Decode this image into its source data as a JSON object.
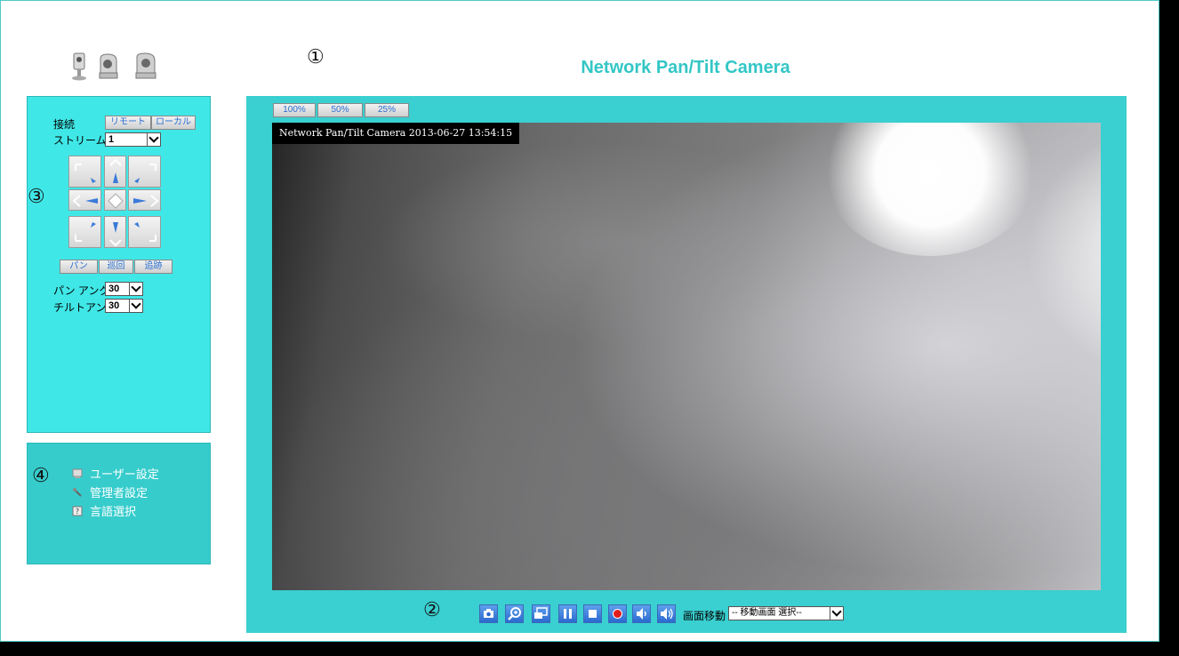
{
  "header": {
    "title": "Network Pan/Tilt Camera",
    "markers": [
      "①",
      "②",
      "③",
      "④"
    ],
    "camera_icons": [
      "box-camera-icon",
      "pan-tilt-camera-icon",
      "dome-camera-icon"
    ]
  },
  "control": {
    "connect_label": "接続",
    "remote_button": "リモート",
    "local_button": "ローカル",
    "stream_label": "ストリーム",
    "stream_value": "1",
    "ptz_buttons": [
      "up-left",
      "up",
      "up-right",
      "left",
      "home",
      "right",
      "down-left",
      "down",
      "down-right"
    ],
    "pan_button": "パン",
    "patrol_button": "巡回",
    "track_button": "追跡",
    "pan_angle_label": "パン アングル",
    "pan_angle_value": "30",
    "tilt_angle_label": "チルトアングル",
    "tilt_angle_value": "30"
  },
  "menu": {
    "items": [
      {
        "label": "ユーザー設定",
        "icon": "user-settings-icon"
      },
      {
        "label": "管理者設定",
        "icon": "admin-settings-icon"
      },
      {
        "label": "言語選択",
        "icon": "language-icon"
      }
    ]
  },
  "view": {
    "zoom_buttons": [
      "100%",
      "50%",
      "25%"
    ],
    "osd_text": "Network Pan/Tilt Camera 2013-06-27 13:54:15",
    "toolbar_icons": [
      "snapshot-icon",
      "zoom-icon",
      "screen-icon",
      "pause-icon",
      "stop-icon",
      "record-icon",
      "speaker-icon",
      "volume-icon"
    ],
    "screen_move_label": "画面移動",
    "screen_move_select": "-- 移動画面 選択--"
  },
  "colors": {
    "accent": "#33c6c6",
    "panel": "#40e7e7",
    "view_bg": "#3acfd0"
  }
}
